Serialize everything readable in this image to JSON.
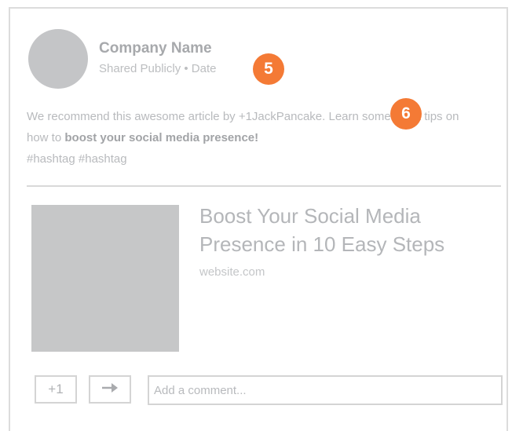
{
  "post": {
    "company_name": "Company Name",
    "meta": "Shared Publicly • Date",
    "text_part1": "We recommend this awesome article by +1JackPancake. Learn some great tips on how to ",
    "text_bold": "boost your social media presence!",
    "hashtags": "#hashtag #hashtag"
  },
  "article": {
    "title": "Boost Your Social Media Presence in 10 Easy Steps",
    "site": "website.com"
  },
  "actions": {
    "plus_one_label": "+1",
    "share_icon": "→",
    "comment_placeholder": "Add a comment..."
  },
  "annotations": {
    "badge_5": "5",
    "badge_6": "6",
    "color": "#f47a35"
  }
}
